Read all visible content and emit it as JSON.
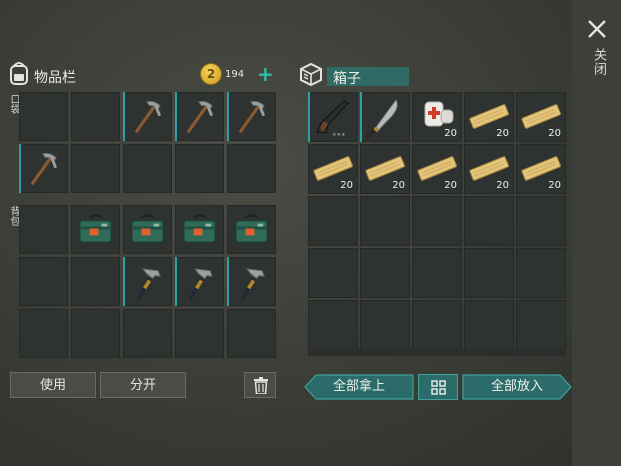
{
  "close": {
    "label": "关闭",
    "icon": "close-icon"
  },
  "inventory": {
    "title": "物品栏",
    "coins": "194",
    "coin_symbol": "2",
    "add_label": "+",
    "pockets_label": "口袋",
    "backpack_label": "背包",
    "pocket_slots": [
      {
        "item": null
      },
      {
        "item": null
      },
      {
        "item": "pickaxe",
        "selected": true
      },
      {
        "item": "pickaxe",
        "selected": true
      },
      {
        "item": "pickaxe",
        "selected": true
      },
      {
        "item": "pickaxe",
        "selected": true
      },
      {
        "item": null
      },
      {
        "item": null
      },
      {
        "item": null
      },
      {
        "item": null
      }
    ],
    "backpack_slots": [
      {
        "item": null
      },
      {
        "item": "medkit-case"
      },
      {
        "item": "medkit-case"
      },
      {
        "item": "medkit-case"
      },
      {
        "item": "medkit-case"
      },
      {
        "item": null
      },
      {
        "item": null
      },
      {
        "item": "hammer",
        "selected": true
      },
      {
        "item": "hammer",
        "selected": true
      },
      {
        "item": "hammer",
        "selected": true
      },
      {
        "item": null
      },
      {
        "item": null
      },
      {
        "item": null
      },
      {
        "item": null
      },
      {
        "item": null
      }
    ]
  },
  "box": {
    "title": "箱子",
    "slots": [
      {
        "item": "shotgun",
        "selected": true
      },
      {
        "item": "machete",
        "selected": true
      },
      {
        "item": "bandage",
        "qty": "20"
      },
      {
        "item": "plank",
        "qty": "20"
      },
      {
        "item": "plank",
        "qty": "20"
      },
      {
        "item": "plank",
        "qty": "20"
      },
      {
        "item": "plank",
        "qty": "20"
      },
      {
        "item": "plank",
        "qty": "20"
      },
      {
        "item": "plank",
        "qty": "20"
      },
      {
        "item": "plank",
        "qty": "20"
      },
      {
        "item": null
      },
      {
        "item": null
      },
      {
        "item": null
      },
      {
        "item": null
      },
      {
        "item": null
      },
      {
        "item": null
      },
      {
        "item": null
      },
      {
        "item": null
      },
      {
        "item": null
      },
      {
        "item": null
      },
      {
        "item": null
      },
      {
        "item": null
      },
      {
        "item": null
      },
      {
        "item": null
      },
      {
        "item": null
      }
    ]
  },
  "buttons": {
    "use": "使用",
    "split": "分开",
    "take_all": "全部拿上",
    "put_all": "全部放入"
  },
  "colors": {
    "accent": "#2aa3a0",
    "button_teal": "#2b6c6a",
    "coin_gold": "#e8b83a"
  }
}
